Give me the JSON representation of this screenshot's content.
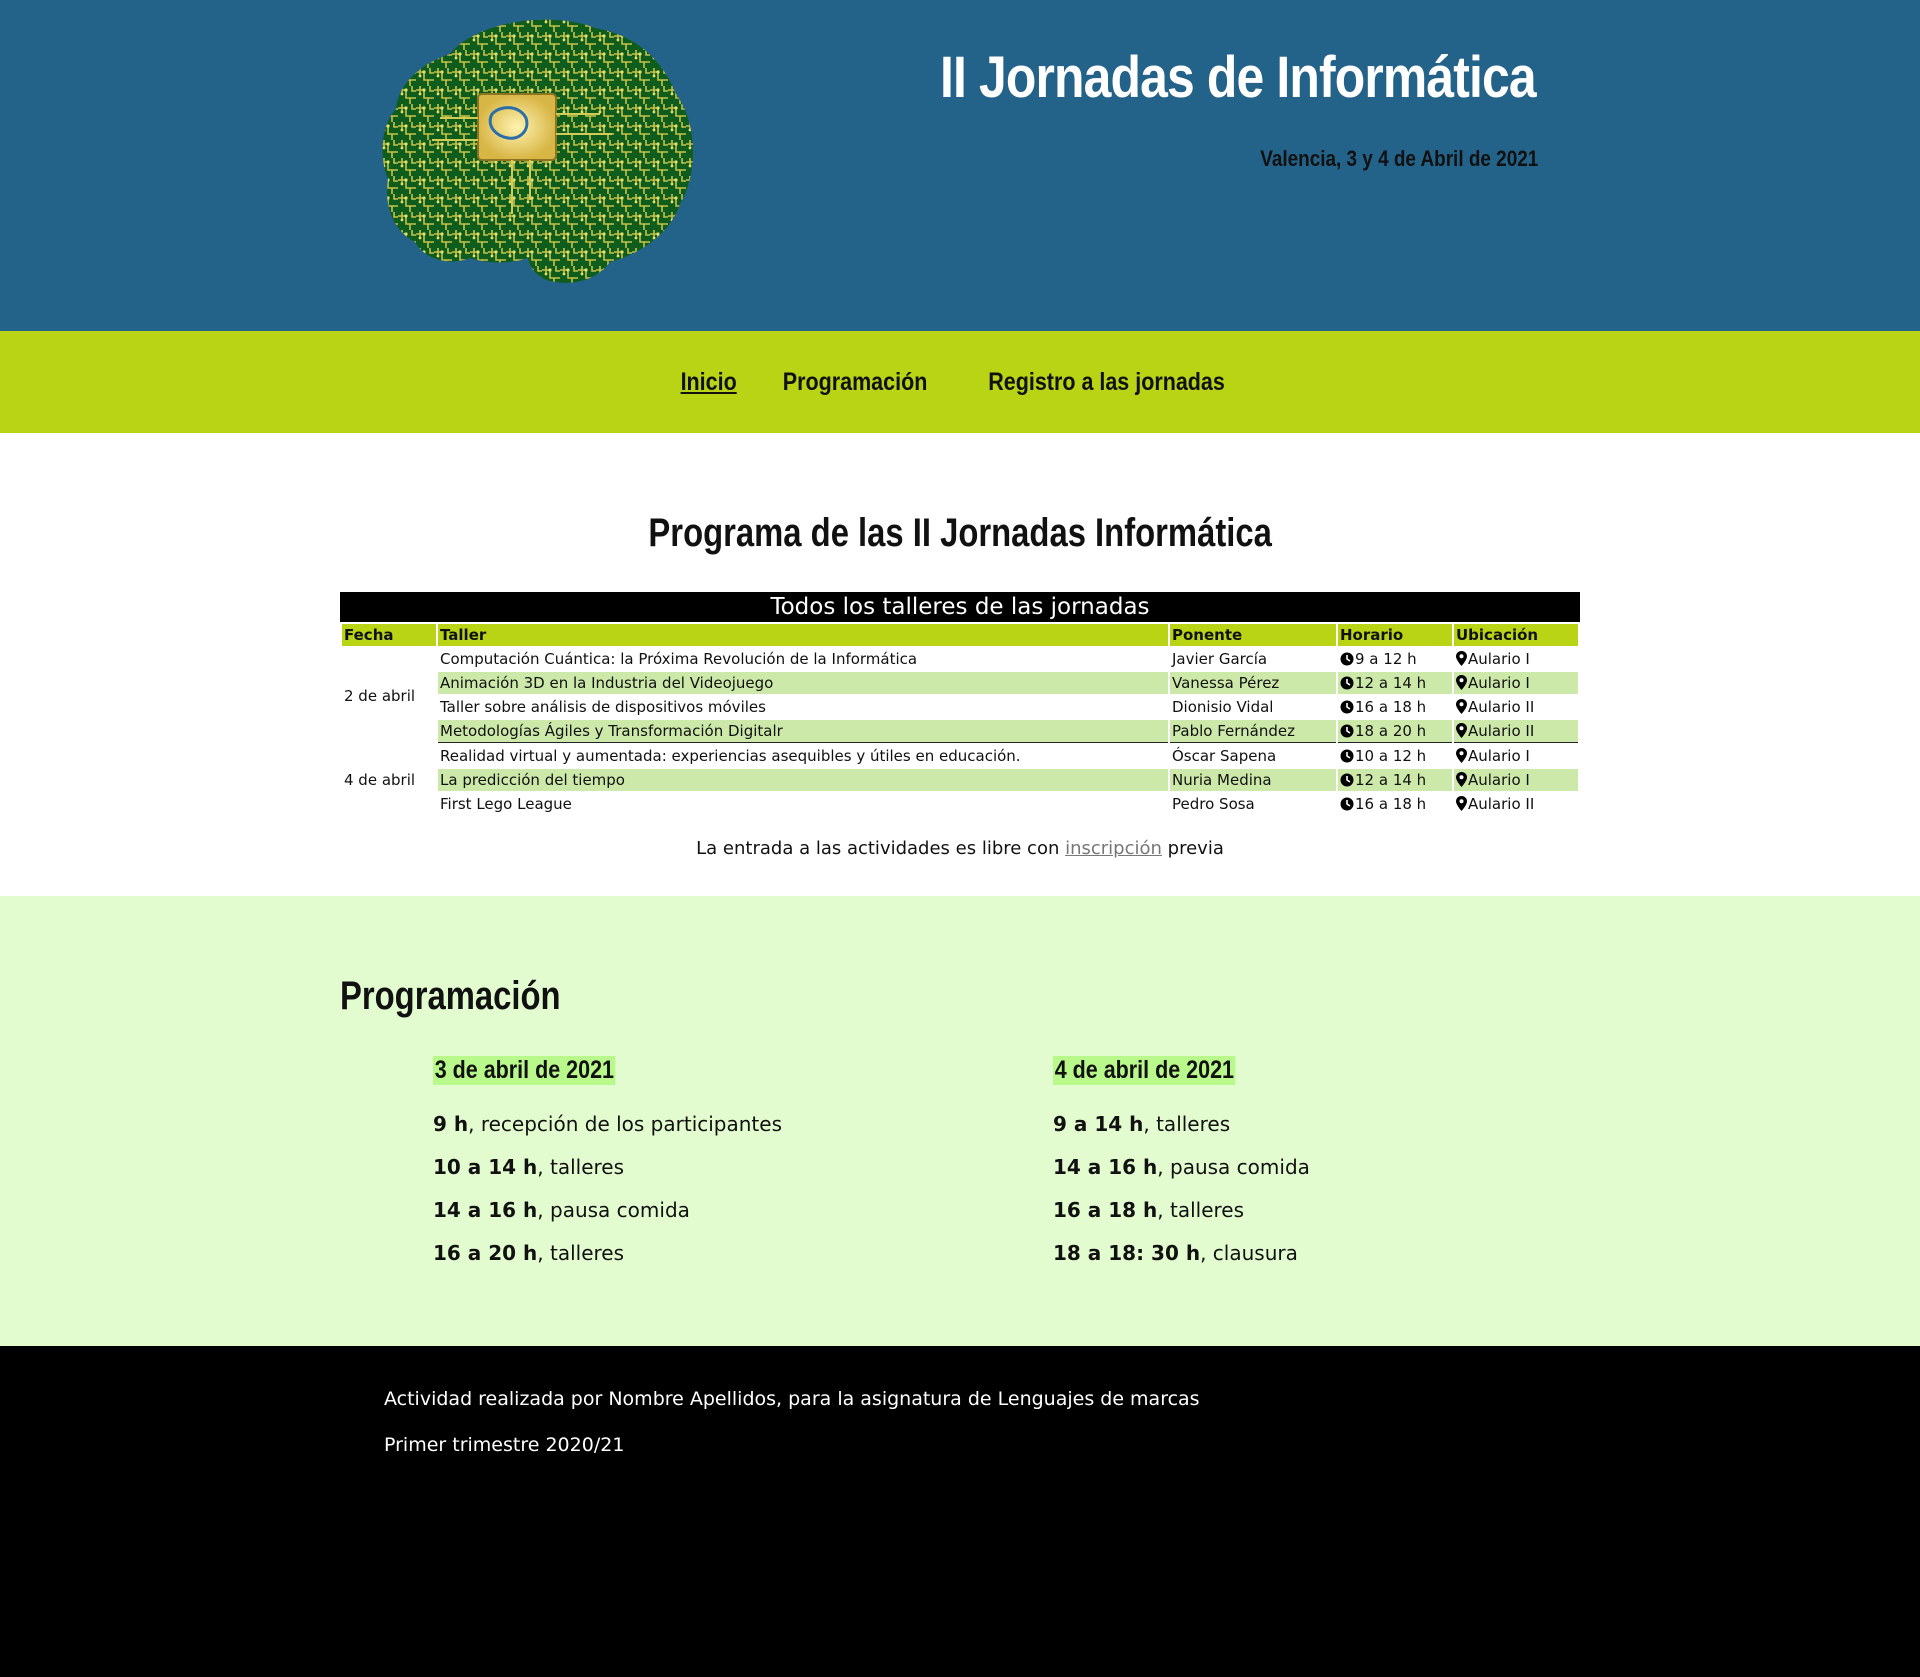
{
  "header": {
    "title": "II Jornadas de Informática",
    "subtitle": "Valencia, 3 y 4 de Abril de 2021",
    "logo_icon": "brain-circuit-icon"
  },
  "nav": {
    "items": [
      {
        "label": "Inicio",
        "active": true
      },
      {
        "label": "Programación",
        "active": false
      },
      {
        "label": "Registro a las jornadas",
        "active": false
      }
    ]
  },
  "program": {
    "title": "Programa de las II Jornadas Informática",
    "caption": "Todos los talleres de las jornadas",
    "headers": [
      "Fecha",
      "Taller",
      "Ponente",
      "Horario",
      "Ubicación"
    ],
    "rows": [
      {
        "fecha": "2 de abril",
        "taller": "Computación Cuántica: la Próxima Revolución de la Informática",
        "ponente": "Javier García",
        "horario": "9 a 12 h",
        "ubicacion": "Aulario I"
      },
      {
        "fecha": "",
        "taller": "Animación 3D en la Industria del Videojuego",
        "ponente": "Vanessa Pérez",
        "horario": "12 a 14 h",
        "ubicacion": "Aulario I"
      },
      {
        "fecha": "",
        "taller": "Taller sobre análisis de dispositivos móviles",
        "ponente": "Dionisio Vidal",
        "horario": "16 a 18 h",
        "ubicacion": "Aulario II"
      },
      {
        "fecha": "",
        "taller": "Metodologías Ágiles y Transformación Digitalr",
        "ponente": "Pablo Fernández",
        "horario": "18 a 20 h",
        "ubicacion": "Aulario II"
      },
      {
        "fecha": "4 de abril",
        "taller": "Realidad virtual y aumentada: experiencias asequibles y útiles en educación.",
        "ponente": "Óscar Sapena",
        "horario": "10 a 12 h",
        "ubicacion": "Aulario I"
      },
      {
        "fecha": "",
        "taller": "La predicción del tiempo",
        "ponente": "Nuria Medina",
        "horario": "12 a 14 h",
        "ubicacion": "Aulario I"
      },
      {
        "fecha": "",
        "taller": "First Lego League",
        "ponente": "Pedro Sosa",
        "horario": "16 a 18 h",
        "ubicacion": "Aulario II"
      }
    ],
    "note_before": "La entrada a las actividades es libre con ",
    "note_link": "inscripción",
    "note_after": " previa"
  },
  "schedule": {
    "title": "Programación",
    "days": [
      {
        "title": "3 de abril de 2021",
        "items": [
          {
            "time": "9 h",
            "text": ", recepción de los participantes"
          },
          {
            "time": "10 a 14 h",
            "text": ", talleres"
          },
          {
            "time": "14 a 16 h",
            "text": ", pausa comida"
          },
          {
            "time": "16 a 20 h",
            "text": ", talleres"
          }
        ]
      },
      {
        "title": "4 de abril de 2021",
        "items": [
          {
            "time": "9 a 14 h",
            "text": ", talleres"
          },
          {
            "time": "14 a 16 h",
            "text": ", pausa comida"
          },
          {
            "time": "16 a 18 h",
            "text": ", talleres"
          },
          {
            "time": "18 a 18: 30 h",
            "text": ", clausura"
          }
        ]
      }
    ]
  },
  "footer": {
    "line1": "Actividad realizada por Nombre Apellidos, para la asignatura de Lenguajes de marcas",
    "line2": "Primer trimestre 2020/21"
  },
  "colors": {
    "header_bg": "#236289",
    "nav_bg": "#b8d415",
    "row_alt": "#cde9a9",
    "schedule_bg": "#e2fcd0",
    "day_highlight": "#b9f88a",
    "footer_bg": "#000000"
  },
  "icons": {
    "clock": "clock-icon",
    "location": "map-pin-icon"
  }
}
